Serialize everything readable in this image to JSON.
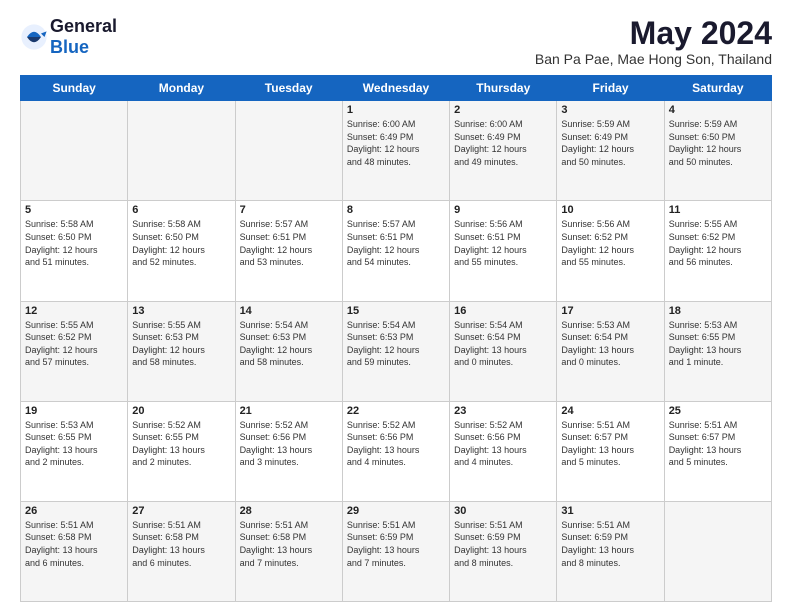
{
  "logo": {
    "general": "General",
    "blue": "Blue"
  },
  "title": "May 2024",
  "location": "Ban Pa Pae, Mae Hong Son, Thailand",
  "weekdays": [
    "Sunday",
    "Monday",
    "Tuesday",
    "Wednesday",
    "Thursday",
    "Friday",
    "Saturday"
  ],
  "weeks": [
    [
      {
        "day": "",
        "info": ""
      },
      {
        "day": "",
        "info": ""
      },
      {
        "day": "",
        "info": ""
      },
      {
        "day": "1",
        "info": "Sunrise: 6:00 AM\nSunset: 6:49 PM\nDaylight: 12 hours\nand 48 minutes."
      },
      {
        "day": "2",
        "info": "Sunrise: 6:00 AM\nSunset: 6:49 PM\nDaylight: 12 hours\nand 49 minutes."
      },
      {
        "day": "3",
        "info": "Sunrise: 5:59 AM\nSunset: 6:49 PM\nDaylight: 12 hours\nand 50 minutes."
      },
      {
        "day": "4",
        "info": "Sunrise: 5:59 AM\nSunset: 6:50 PM\nDaylight: 12 hours\nand 50 minutes."
      }
    ],
    [
      {
        "day": "5",
        "info": "Sunrise: 5:58 AM\nSunset: 6:50 PM\nDaylight: 12 hours\nand 51 minutes."
      },
      {
        "day": "6",
        "info": "Sunrise: 5:58 AM\nSunset: 6:50 PM\nDaylight: 12 hours\nand 52 minutes."
      },
      {
        "day": "7",
        "info": "Sunrise: 5:57 AM\nSunset: 6:51 PM\nDaylight: 12 hours\nand 53 minutes."
      },
      {
        "day": "8",
        "info": "Sunrise: 5:57 AM\nSunset: 6:51 PM\nDaylight: 12 hours\nand 54 minutes."
      },
      {
        "day": "9",
        "info": "Sunrise: 5:56 AM\nSunset: 6:51 PM\nDaylight: 12 hours\nand 55 minutes."
      },
      {
        "day": "10",
        "info": "Sunrise: 5:56 AM\nSunset: 6:52 PM\nDaylight: 12 hours\nand 55 minutes."
      },
      {
        "day": "11",
        "info": "Sunrise: 5:55 AM\nSunset: 6:52 PM\nDaylight: 12 hours\nand 56 minutes."
      }
    ],
    [
      {
        "day": "12",
        "info": "Sunrise: 5:55 AM\nSunset: 6:52 PM\nDaylight: 12 hours\nand 57 minutes."
      },
      {
        "day": "13",
        "info": "Sunrise: 5:55 AM\nSunset: 6:53 PM\nDaylight: 12 hours\nand 58 minutes."
      },
      {
        "day": "14",
        "info": "Sunrise: 5:54 AM\nSunset: 6:53 PM\nDaylight: 12 hours\nand 58 minutes."
      },
      {
        "day": "15",
        "info": "Sunrise: 5:54 AM\nSunset: 6:53 PM\nDaylight: 12 hours\nand 59 minutes."
      },
      {
        "day": "16",
        "info": "Sunrise: 5:54 AM\nSunset: 6:54 PM\nDaylight: 13 hours\nand 0 minutes."
      },
      {
        "day": "17",
        "info": "Sunrise: 5:53 AM\nSunset: 6:54 PM\nDaylight: 13 hours\nand 0 minutes."
      },
      {
        "day": "18",
        "info": "Sunrise: 5:53 AM\nSunset: 6:55 PM\nDaylight: 13 hours\nand 1 minute."
      }
    ],
    [
      {
        "day": "19",
        "info": "Sunrise: 5:53 AM\nSunset: 6:55 PM\nDaylight: 13 hours\nand 2 minutes."
      },
      {
        "day": "20",
        "info": "Sunrise: 5:52 AM\nSunset: 6:55 PM\nDaylight: 13 hours\nand 2 minutes."
      },
      {
        "day": "21",
        "info": "Sunrise: 5:52 AM\nSunset: 6:56 PM\nDaylight: 13 hours\nand 3 minutes."
      },
      {
        "day": "22",
        "info": "Sunrise: 5:52 AM\nSunset: 6:56 PM\nDaylight: 13 hours\nand 4 minutes."
      },
      {
        "day": "23",
        "info": "Sunrise: 5:52 AM\nSunset: 6:56 PM\nDaylight: 13 hours\nand 4 minutes."
      },
      {
        "day": "24",
        "info": "Sunrise: 5:51 AM\nSunset: 6:57 PM\nDaylight: 13 hours\nand 5 minutes."
      },
      {
        "day": "25",
        "info": "Sunrise: 5:51 AM\nSunset: 6:57 PM\nDaylight: 13 hours\nand 5 minutes."
      }
    ],
    [
      {
        "day": "26",
        "info": "Sunrise: 5:51 AM\nSunset: 6:58 PM\nDaylight: 13 hours\nand 6 minutes."
      },
      {
        "day": "27",
        "info": "Sunrise: 5:51 AM\nSunset: 6:58 PM\nDaylight: 13 hours\nand 6 minutes."
      },
      {
        "day": "28",
        "info": "Sunrise: 5:51 AM\nSunset: 6:58 PM\nDaylight: 13 hours\nand 7 minutes."
      },
      {
        "day": "29",
        "info": "Sunrise: 5:51 AM\nSunset: 6:59 PM\nDaylight: 13 hours\nand 7 minutes."
      },
      {
        "day": "30",
        "info": "Sunrise: 5:51 AM\nSunset: 6:59 PM\nDaylight: 13 hours\nand 8 minutes."
      },
      {
        "day": "31",
        "info": "Sunrise: 5:51 AM\nSunset: 6:59 PM\nDaylight: 13 hours\nand 8 minutes."
      },
      {
        "day": "",
        "info": ""
      }
    ]
  ]
}
